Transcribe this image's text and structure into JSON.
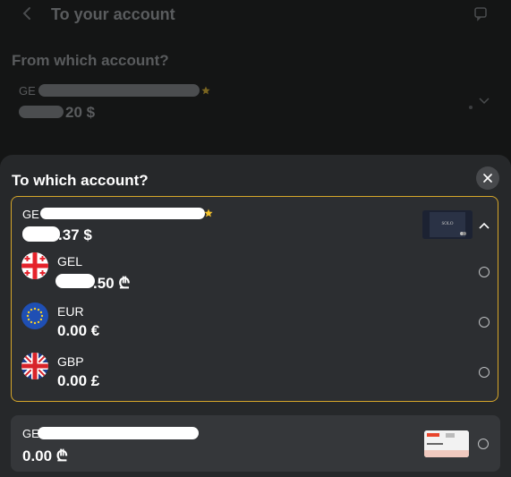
{
  "header": {
    "title": "To your account",
    "back_icon": "chevron-left-icon",
    "chat_icon": "chat-icon"
  },
  "from_section": {
    "title": "From which account?",
    "account": {
      "name_prefix": "GE",
      "amount_suffix": "20 $"
    }
  },
  "sheet": {
    "title": "To which account?",
    "close_icon": "close-icon",
    "selected_account": {
      "name_prefix": "GE",
      "amount_suffix": ".37 $",
      "accent_color": "#d7a72a",
      "sub_accounts": [
        {
          "code": "GEL",
          "amount": ".50 ₾",
          "flag_icon": "georgia-flag-icon"
        },
        {
          "code": "EUR",
          "amount": "0.00 €",
          "flag_icon": "eu-flag-icon"
        },
        {
          "code": "GBP",
          "amount": "0.00 £",
          "flag_icon": "uk-flag-icon"
        }
      ]
    },
    "other_account": {
      "name_prefix": "GE",
      "amount": "0.00 ₾"
    }
  }
}
